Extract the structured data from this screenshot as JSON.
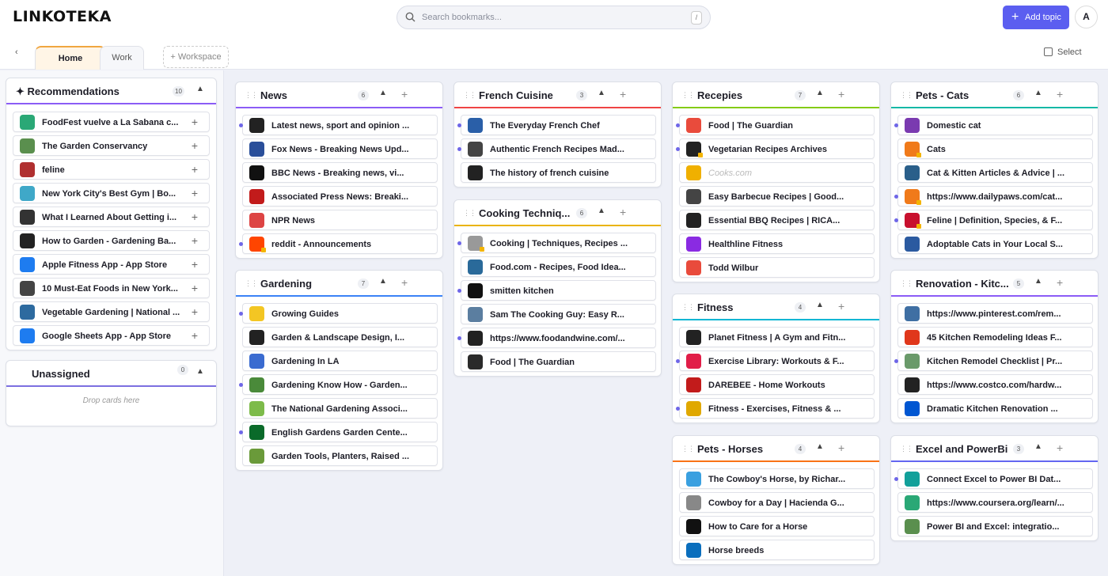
{
  "app": {
    "logo": "LINKOTEKA"
  },
  "search": {
    "placeholder": "Search bookmarks...",
    "shortcut": "/"
  },
  "header": {
    "add_topic": "Add topic",
    "avatar": "A",
    "select": "Select"
  },
  "workspaces": {
    "tabs": [
      {
        "label": "Home",
        "active": true
      },
      {
        "label": "Work",
        "active": false
      }
    ],
    "add_label": "+ Workspace"
  },
  "sidebar": {
    "recommendations": {
      "title": "✦ Recommendations",
      "count": "10",
      "items": [
        "FoodFest vuelve a La Sabana c...",
        "The Garden Conservancy",
        "feline",
        "New York City's Best Gym | Bo...",
        "What I Learned About Getting i...",
        "How to Garden - Gardening Ba...",
        "Apple Fitness App - App Store",
        "10 Must-Eat Foods in New York...",
        "Vegetable Gardening | National ...",
        "Google Sheets App - App Store"
      ]
    },
    "unassigned": {
      "title": "Unassigned",
      "count": "0",
      "hint": "Drop cards here"
    }
  },
  "topics": [
    {
      "title": "News",
      "count": "6",
      "color": "#8b5cf6",
      "items": [
        "Latest news, sport and opinion ...",
        "Fox News - Breaking News Upd...",
        "BBC News - Breaking news, vi...",
        "Associated Press News: Breaki...",
        "NPR News",
        "reddit - Announcements"
      ]
    },
    {
      "title": "Gardening",
      "count": "7",
      "color": "#3b82f6",
      "items": [
        "Growing Guides",
        "Garden & Landscape Design, I...",
        "Gardening In LA",
        "Gardening Know How - Garden...",
        "The National Gardening Associ...",
        "English Gardens Garden Cente...",
        "Garden Tools, Planters, Raised ..."
      ]
    },
    {
      "title": "French Cuisine",
      "count": "3",
      "color": "#ef4444",
      "items": [
        "The Everyday French Chef",
        "Authentic French Recipes Mad...",
        "The history of french cuisine"
      ]
    },
    {
      "title": "Cooking Techniq...",
      "count": "6",
      "color": "#eab308",
      "items": [
        "Cooking | Techniques, Recipes ...",
        "Food.com - Recipes, Food Idea...",
        "smitten kitchen",
        "Sam The Cooking Guy: Easy R...",
        "https://www.foodandwine.com/...",
        "Food | The Guardian"
      ]
    },
    {
      "title": "Recepies",
      "count": "7",
      "color": "#84cc16",
      "items": [
        "Food | The Guardian",
        "Vegetarian Recipes Archives",
        "Cooks.com",
        "Easy Barbecue Recipes | Good...",
        "Essential BBQ Recipes | RICA...",
        "Healthline Fitness",
        "Todd Wilbur"
      ]
    },
    {
      "title": "Fitness",
      "count": "4",
      "color": "#06b6d4",
      "items": [
        "Planet Fitness | A Gym and Fitn...",
        "Exercise Library: Workouts & F...",
        "DAREBEE - Home Workouts",
        "Fitness - Exercises, Fitness & ..."
      ]
    },
    {
      "title": "Pets - Horses",
      "count": "4",
      "color": "#f97316",
      "items": [
        "The Cowboy's Horse, by Richar...",
        "Cowboy for a Day | Hacienda G...",
        "How to Care for a Horse",
        "Horse breeds"
      ]
    },
    {
      "title": "Pets - Cats",
      "count": "6",
      "color": "#14b8a6",
      "items": [
        "Domestic cat",
        "Cats",
        "Cat & Kitten Articles & Advice | ...",
        "https://www.dailypaws.com/cat...",
        "Feline | Definition, Species, & F...",
        "Adoptable Cats in Your Local S..."
      ]
    },
    {
      "title": "Renovation - Kitc...",
      "count": "5",
      "color": "#8b5cf6",
      "items": [
        "https://www.pinterest.com/rem...",
        "45 Kitchen Remodeling Ideas F...",
        "Kitchen Remodel Checklist | Pr...",
        "https://www.costco.com/hardw...",
        "Dramatic Kitchen Renovation ..."
      ]
    },
    {
      "title": "Excel and PowerBi",
      "count": "3",
      "color": "#6366f1",
      "items": [
        "Connect Excel to Power BI Dat...",
        "https://www.coursera.org/learn/...",
        "Power BI and Excel: integratio..."
      ]
    }
  ]
}
